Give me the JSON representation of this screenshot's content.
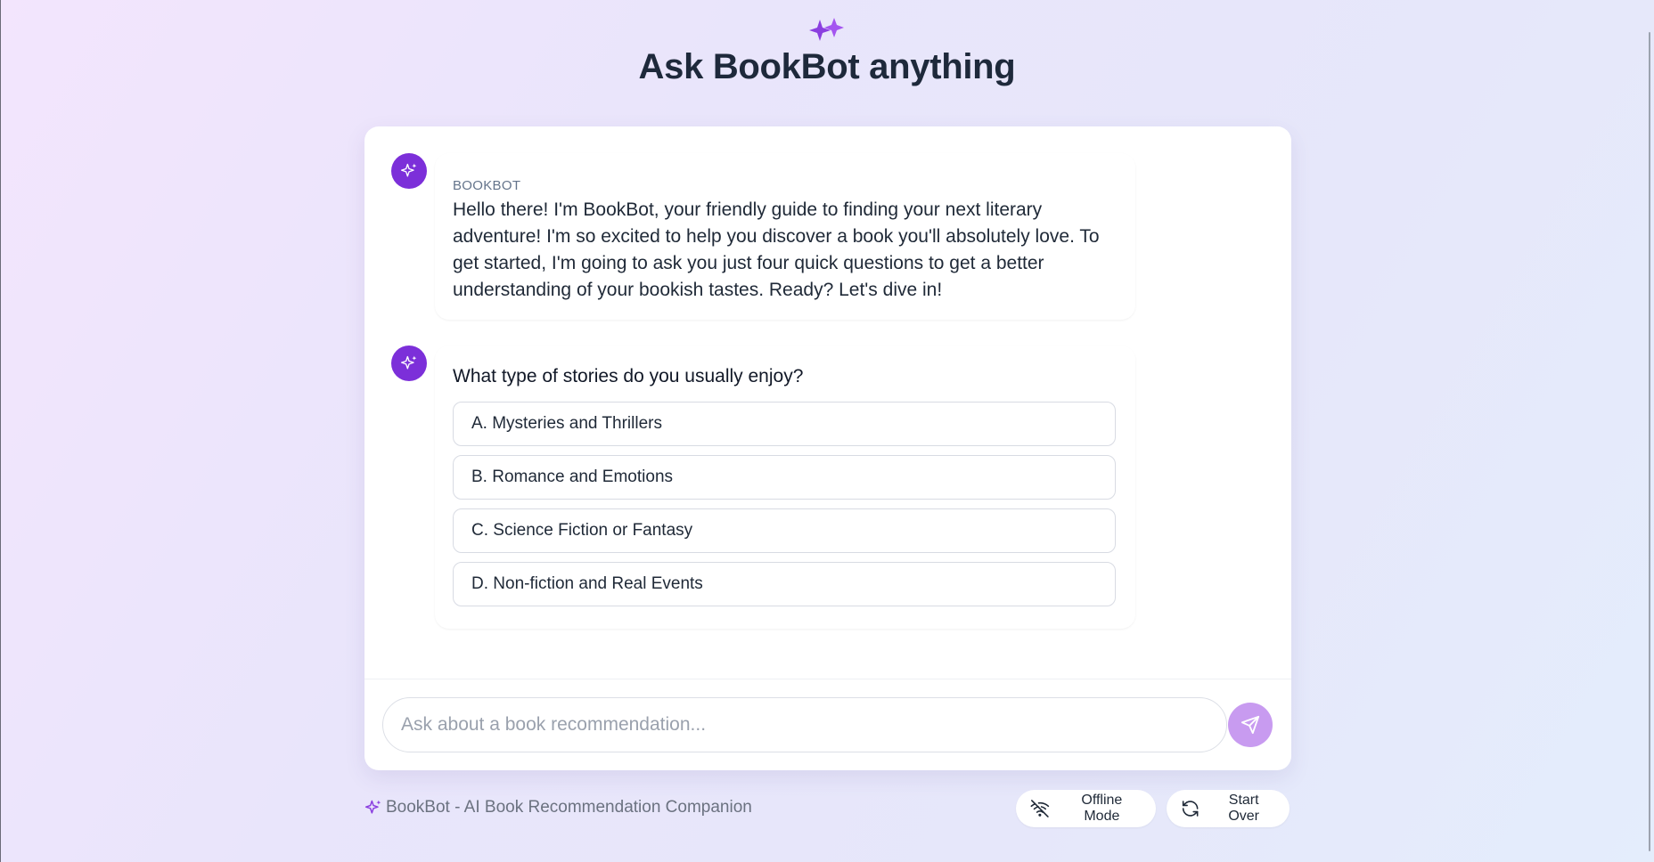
{
  "colors": {
    "accent": "#7c2fd9",
    "send_button": "#c89bf0",
    "title": "#1e293b",
    "muted": "#6b7280"
  },
  "header": {
    "icon": "sparkles-icon",
    "title": "Ask BookBot anything"
  },
  "messages": [
    {
      "avatar_icon": "sparkles-icon",
      "sender": "BOOKBOT",
      "text": "Hello there! I'm BookBot, your friendly guide to finding your next literary adventure! I'm so excited to help you discover a book you'll absolutely love. To get started, I'm going to ask you just four quick questions to get a better understanding of your bookish tastes. Ready? Let's dive in!"
    },
    {
      "avatar_icon": "sparkles-icon",
      "question": "What type of stories do you usually enjoy?",
      "options": [
        {
          "label": "A. Mysteries and Thrillers"
        },
        {
          "label": "B. Romance and Emotions"
        },
        {
          "label": "C. Science Fiction or Fantasy"
        },
        {
          "label": "D. Non-fiction and Real Events"
        }
      ]
    }
  ],
  "composer": {
    "placeholder": "Ask about a book recommendation...",
    "value": "",
    "send_icon": "send-icon"
  },
  "footer": {
    "brand_icon": "sparkles-icon",
    "brand_text": "BookBot - AI Book Recommendation Companion",
    "offline": {
      "icon": "wifi-off-icon",
      "label": "Offline Mode"
    },
    "restart": {
      "icon": "refresh-icon",
      "label": "Start Over"
    }
  }
}
